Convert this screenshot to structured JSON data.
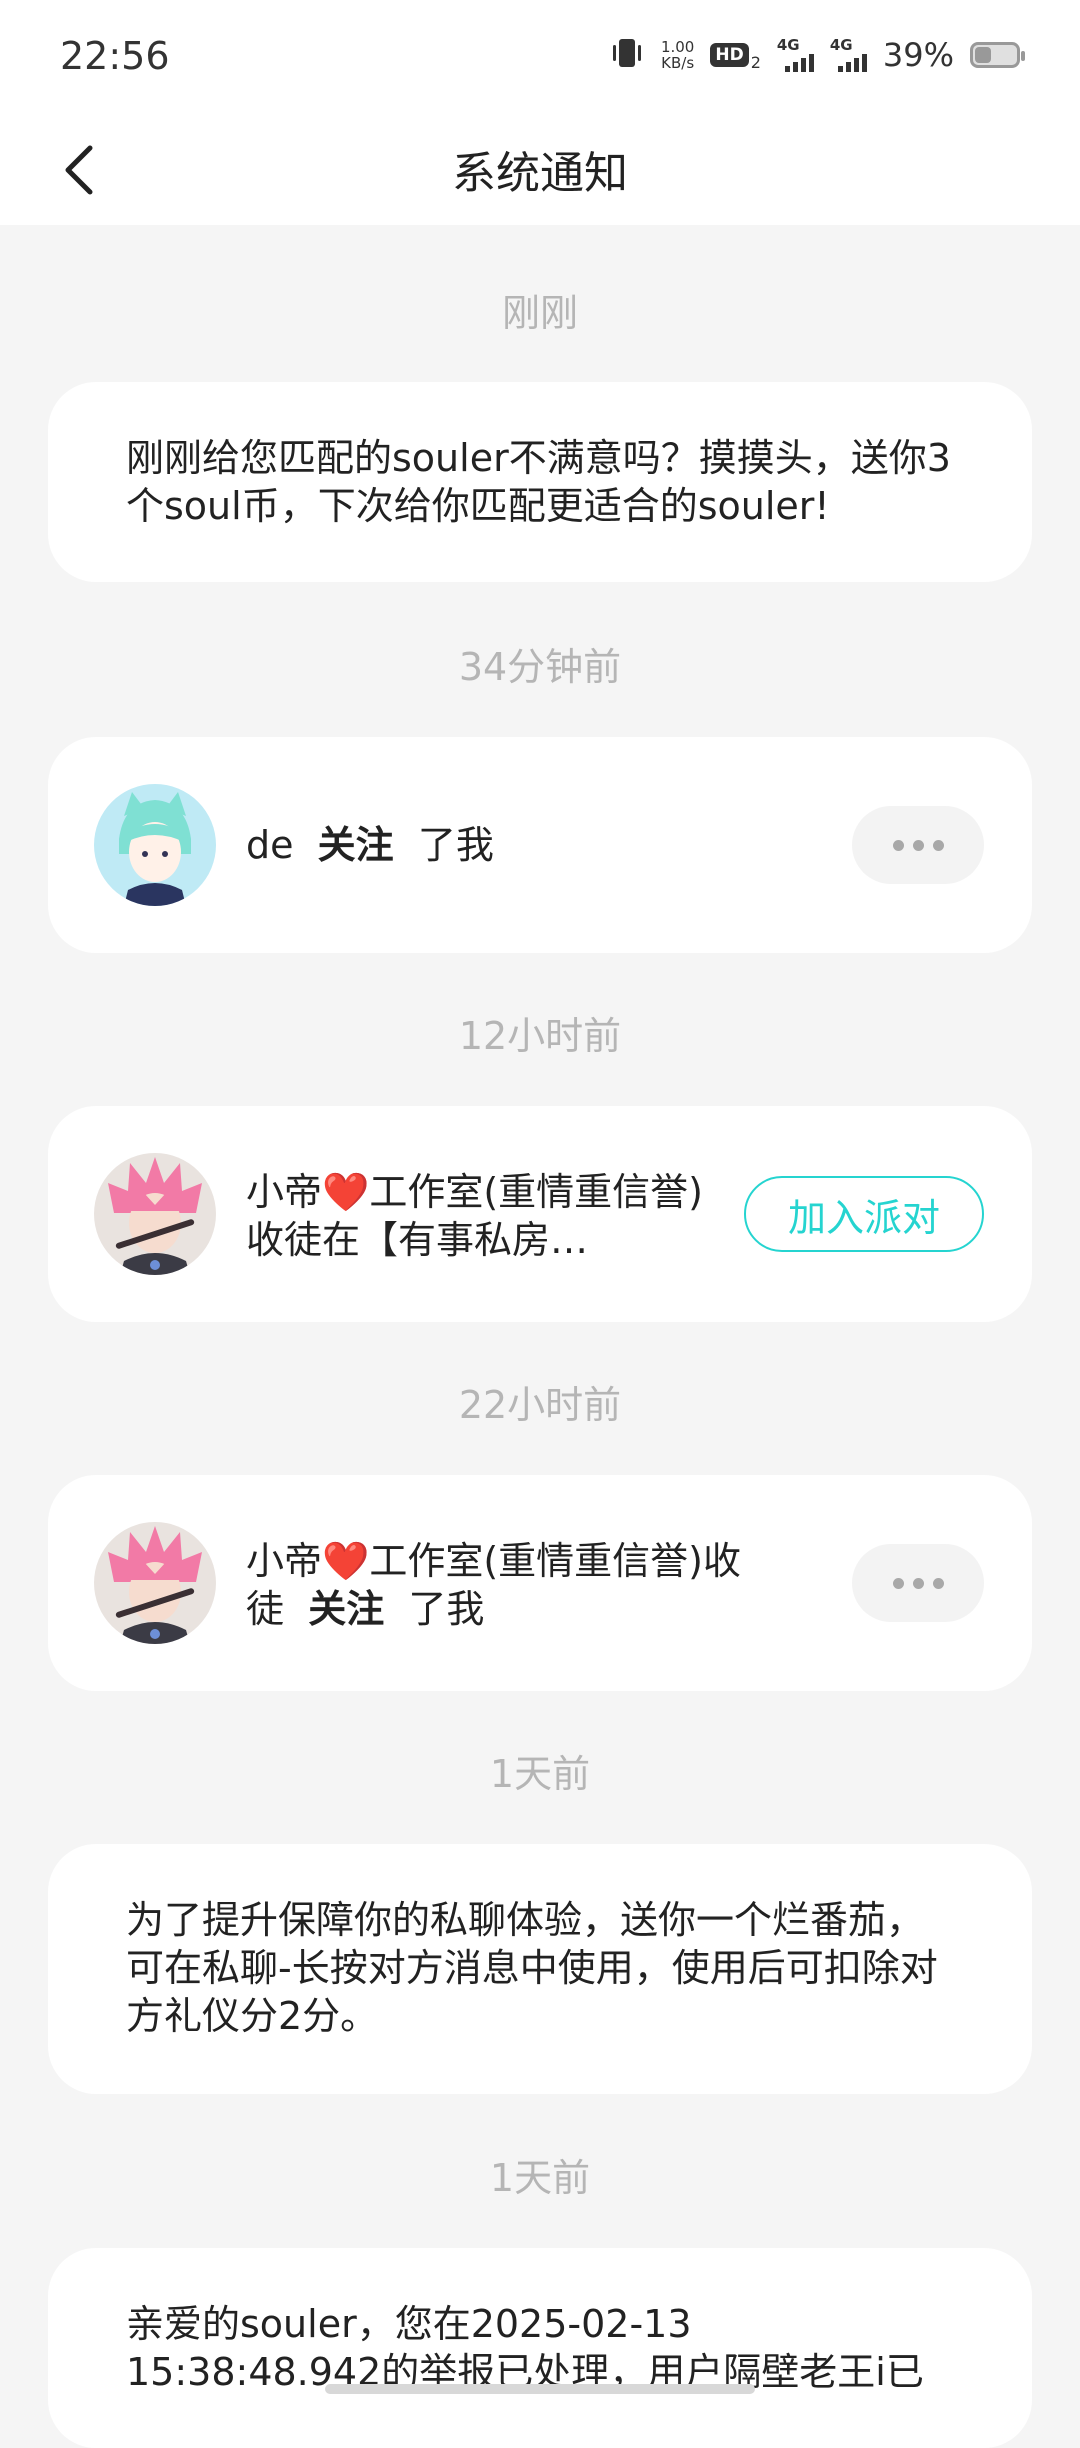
{
  "status_bar": {
    "time": "22:56",
    "net_speed_value": "1.00",
    "net_speed_unit": "KB/s",
    "hd_label": "HD",
    "hd_sub": "2",
    "sim1_label": "4G",
    "sim2_label": "4G",
    "battery_percent": "39%",
    "battery_level": 0.39
  },
  "header": {
    "title": "系统通知",
    "back_icon": "chevron-left-icon"
  },
  "notifications": [
    {
      "time": "刚刚",
      "text": "刚刚给您匹配的souler不满意吗？摸摸头，送你3个soul币，下次给你匹配更适合的souler!"
    },
    {
      "time": "34分钟前",
      "user": "de",
      "action": "关注",
      "suffix": "了我"
    },
    {
      "time": "12小时前",
      "user_prefix": "小帝",
      "heart": "❤️",
      "text": "工作室(重情重信誉)收徒在【有事私房…",
      "button": "加入派对"
    },
    {
      "time": "22小时前",
      "user_prefix": "小帝",
      "heart": "❤️",
      "text_line1": "工作室(重情重信誉)收",
      "text_line2_prefix": "徒",
      "action": "关注",
      "suffix": "了我"
    },
    {
      "time": "1天前",
      "text": "为了提升保障你的私聊体验，送你一个烂番茄，可在私聊-长按对方消息中使用，使用后可扣除对方礼仪分2分。"
    },
    {
      "time": "1天前",
      "text": "亲爱的souler，您在2025-02-13 15:38:48.942的举报已处理，用户隔壁老王i已"
    }
  ],
  "colors": {
    "accent": "#25d4d0",
    "background": "#f5f5f5",
    "card": "#ffffff",
    "timestamp": "#b5b5b5",
    "heart": "#e8231f"
  }
}
